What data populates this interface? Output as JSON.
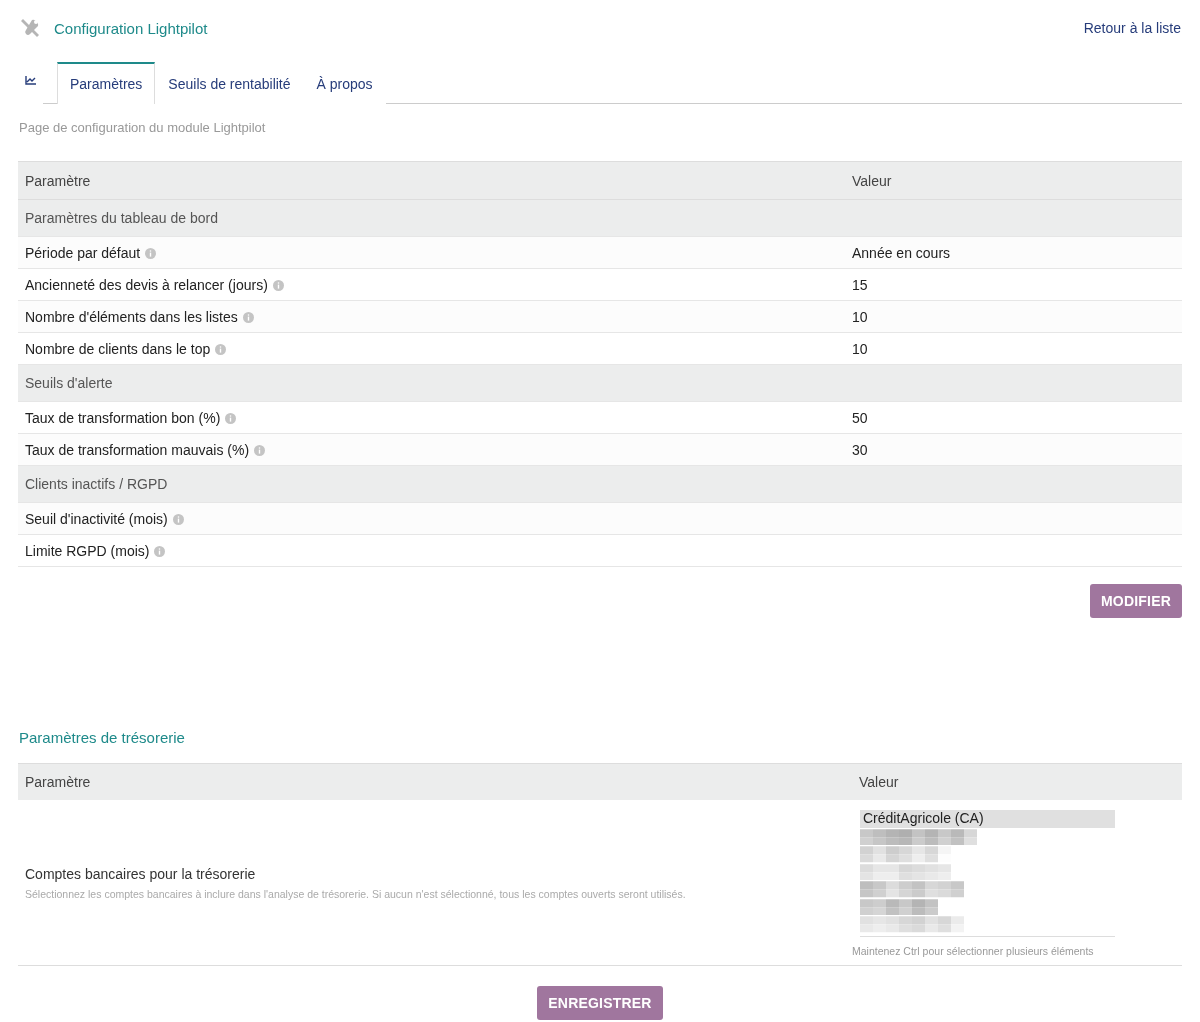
{
  "header": {
    "title": "Configuration Lightpilot",
    "back_link": "Retour à la liste"
  },
  "tabs": [
    {
      "kind": "icon",
      "selected": false
    },
    {
      "kind": "text",
      "label": "Paramètres",
      "selected": true
    },
    {
      "kind": "text",
      "label": "Seuils de rentabilité",
      "selected": false
    },
    {
      "kind": "text",
      "label": "À propos",
      "selected": false
    }
  ],
  "subtitle": "Page de configuration du module Lightpilot",
  "params_table": {
    "columns": [
      "Paramètre",
      "Valeur"
    ],
    "rows": [
      {
        "kind": "section",
        "label": "Paramètres du tableau de bord"
      },
      {
        "kind": "param",
        "label": "Période par défaut",
        "value": "Année en cours"
      },
      {
        "kind": "param",
        "label": "Ancienneté des devis à relancer (jours)",
        "value": "15"
      },
      {
        "kind": "param",
        "label": "Nombre d'éléments dans les listes",
        "value": "10"
      },
      {
        "kind": "param",
        "label": "Nombre de clients dans le top",
        "value": "10"
      },
      {
        "kind": "section",
        "label": "Seuils d'alerte"
      },
      {
        "kind": "param",
        "label": "Taux de transformation bon (%)",
        "value": "50"
      },
      {
        "kind": "param",
        "label": "Taux de transformation mauvais (%)",
        "value": "30"
      },
      {
        "kind": "section",
        "label": "Clients inactifs / RGPD"
      },
      {
        "kind": "param",
        "label": "Seuil d'inactivité (mois)"
      },
      {
        "kind": "param",
        "label": "Limite RGPD (mois)"
      }
    ]
  },
  "modify_button": "MODIFIER",
  "treasury": {
    "title": "Paramètres de trésorerie",
    "columns": [
      "Paramètre",
      "Valeur"
    ],
    "row": {
      "label": "Comptes bancaires pour la trésorerie",
      "help": "Sélectionnez les comptes bancaires à inclure dans l'analyse de trésorerie. Si aucun n'est sélectionné, tous les comptes ouverts seront utilisés.",
      "options": [
        {
          "kind": "text",
          "label": "CréditAgricole (CA)",
          "selected": true
        },
        {
          "kind": "redacted",
          "selected": false
        },
        {
          "kind": "redacted",
          "selected": false
        },
        {
          "kind": "redacted",
          "selected": false
        },
        {
          "kind": "redacted",
          "selected": false
        },
        {
          "kind": "redacted",
          "selected": false
        },
        {
          "kind": "redacted",
          "selected": false
        }
      ],
      "hint": "Maintenez Ctrl pour sélectionner plusieurs éléments"
    }
  },
  "save_button": "ENREGISTRER"
}
